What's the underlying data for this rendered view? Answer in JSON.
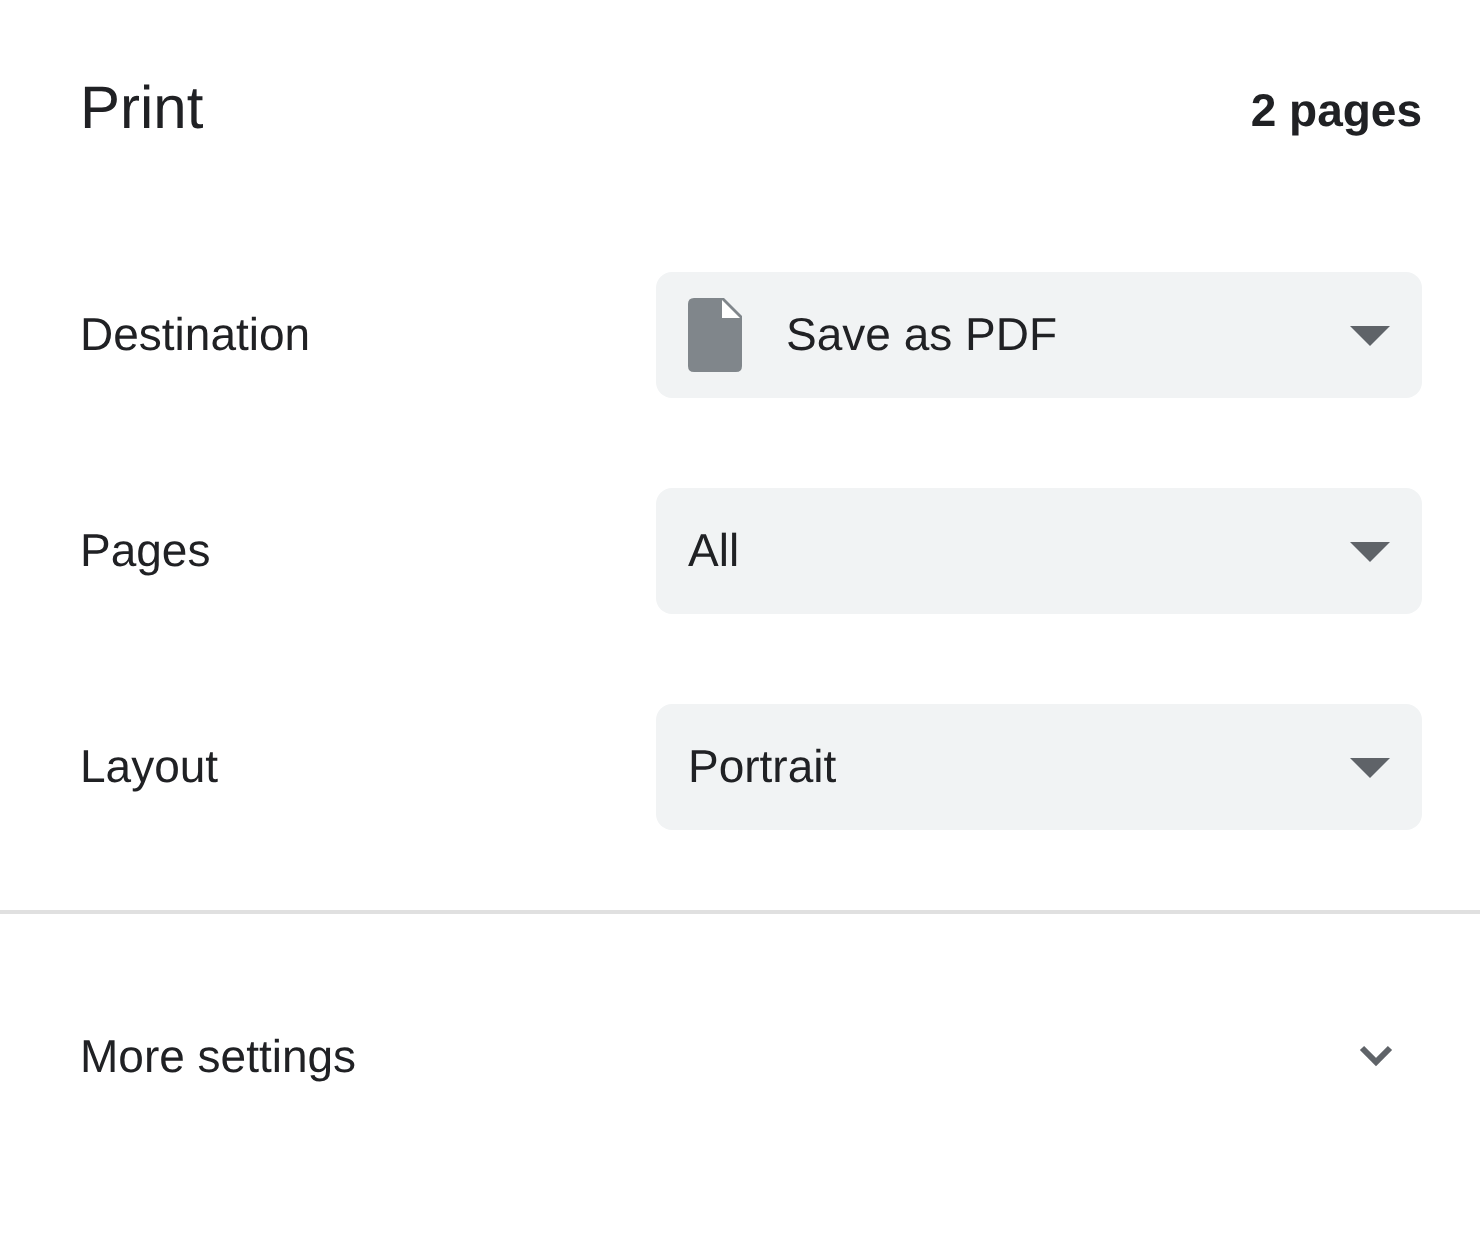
{
  "header": {
    "title": "Print",
    "page_count": "2 pages"
  },
  "settings": [
    {
      "label": "Destination",
      "value": "Save as PDF",
      "kind": "icon-select"
    },
    {
      "label": "Pages",
      "value": "All",
      "kind": "select"
    },
    {
      "label": "Layout",
      "value": "Portrait",
      "kind": "select"
    }
  ],
  "more_settings": {
    "label": "More settings",
    "expanded": false
  }
}
